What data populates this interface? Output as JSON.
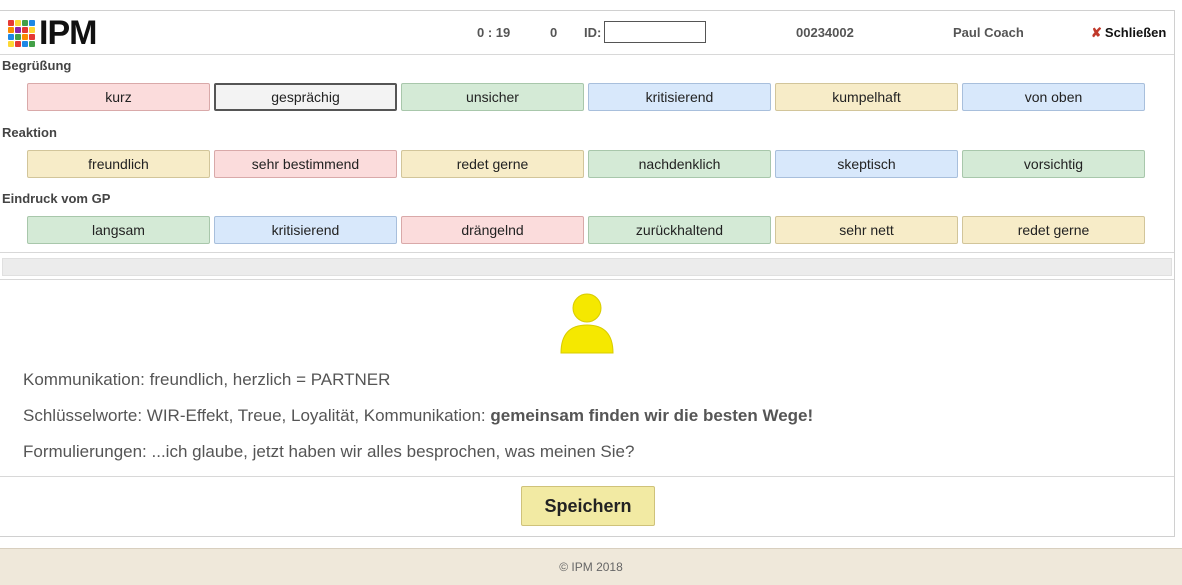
{
  "header": {
    "logo_text": "IPM",
    "timer": "0 : 19",
    "count": "0",
    "id_label": "ID:",
    "id_value": "",
    "number": "00234002",
    "user": "Paul Coach",
    "close_label": "Schließen",
    "close_icon": "x-icon"
  },
  "sections": [
    {
      "title": "Begrüßung",
      "options": [
        {
          "label": "kurz",
          "color": "red"
        },
        {
          "label": "gesprächig",
          "color": "grey",
          "selected": true
        },
        {
          "label": "unsicher",
          "color": "green"
        },
        {
          "label": "kritisierend",
          "color": "blue"
        },
        {
          "label": "kumpelhaft",
          "color": "yellow"
        },
        {
          "label": "von oben",
          "color": "blue"
        }
      ]
    },
    {
      "title": "Reaktion",
      "options": [
        {
          "label": "freundlich",
          "color": "yellow"
        },
        {
          "label": "sehr bestimmend",
          "color": "red"
        },
        {
          "label": "redet gerne",
          "color": "yellow"
        },
        {
          "label": "nachdenklich",
          "color": "green"
        },
        {
          "label": "skeptisch",
          "color": "blue"
        },
        {
          "label": "vorsichtig",
          "color": "green"
        }
      ]
    },
    {
      "title": "Eindruck vom GP",
      "options": [
        {
          "label": "langsam",
          "color": "green"
        },
        {
          "label": "kritisierend",
          "color": "blue"
        },
        {
          "label": "drängelnd",
          "color": "red"
        },
        {
          "label": "zurückhaltend",
          "color": "green"
        },
        {
          "label": "sehr nett",
          "color": "yellow"
        },
        {
          "label": "redet gerne",
          "color": "yellow"
        }
      ]
    }
  ],
  "result": {
    "avatar_icon": "person-icon",
    "avatar_color": "#f5e800",
    "line1": "Kommunikation: freundlich, herzlich = PARTNER",
    "line2_prefix": "Schlüsselworte: WIR-Effekt, Treue, Loyalität, Kommunikation: ",
    "line2_bold": "gemeinsam finden wir die besten Wege!",
    "line3": "Formulierungen: ...ich glaube, jetzt haben wir alles besprochen, was meinen Sie?"
  },
  "save_label": "Speichern",
  "footer_text": "© IPM 2018",
  "colors": {
    "red": "#fbdcdc",
    "green": "#d4ead6",
    "blue": "#d8e8fb",
    "yellow": "#f7ecc8",
    "save": "#f2eaa3",
    "footer": "#efe8da"
  }
}
